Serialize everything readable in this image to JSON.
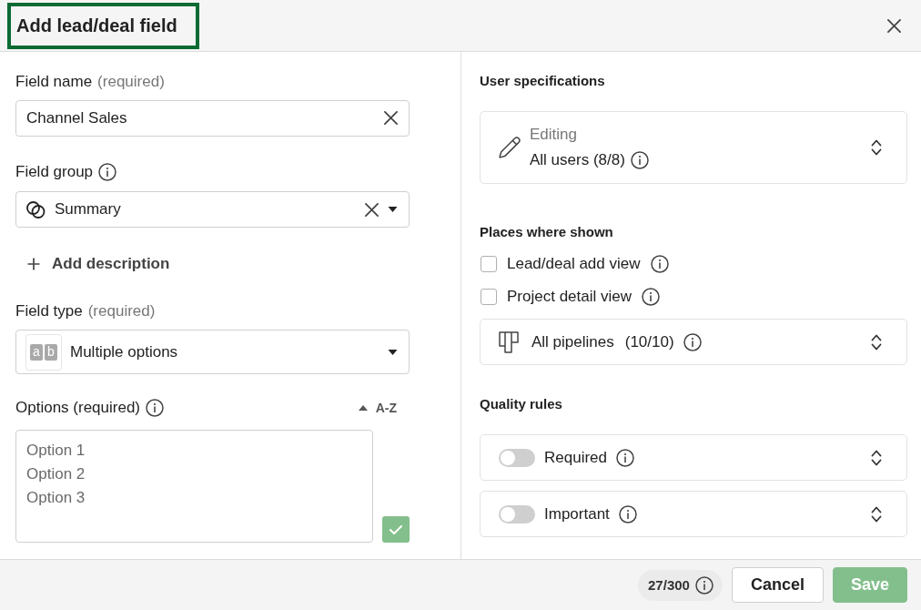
{
  "dialog": {
    "title": {
      "text": "Add lead/deal field",
      "highlighted": true
    }
  },
  "field_name": {
    "label": "Field name",
    "hint": "(required)",
    "value": "Channel Sales"
  },
  "field_group": {
    "label": "Field group",
    "value": "Summary"
  },
  "add_description": {
    "label": "Add description"
  },
  "field_type": {
    "label": "Field type",
    "hint": "(required)",
    "icon_letters": [
      "a",
      "b"
    ],
    "value": "Multiple options"
  },
  "options": {
    "label": "Options (required)",
    "sort_label": "A-Z",
    "placeholder": [
      "Option 1",
      "Option 2",
      "Option 3"
    ]
  },
  "user_specifications": {
    "heading": "User specifications",
    "permission": {
      "label": "Editing",
      "value": "All users (8/8)"
    }
  },
  "places_where_shown": {
    "heading": "Places where shown",
    "views": [
      {
        "label": "Lead/deal add view",
        "checked": false
      },
      {
        "label": "Project detail view",
        "checked": false
      }
    ],
    "pipelines": {
      "label": "All pipelines",
      "count": "(10/10)"
    }
  },
  "quality_rules": {
    "heading": "Quality rules",
    "rules": [
      {
        "label": "Required",
        "on": false
      },
      {
        "label": "Important",
        "on": false
      }
    ]
  },
  "footer": {
    "counter": "27/300",
    "buttons": [
      {
        "label": "Cancel",
        "kind": "secondary",
        "disabled": false
      },
      {
        "label": "Save",
        "kind": "primary",
        "disabled": true
      }
    ]
  }
}
